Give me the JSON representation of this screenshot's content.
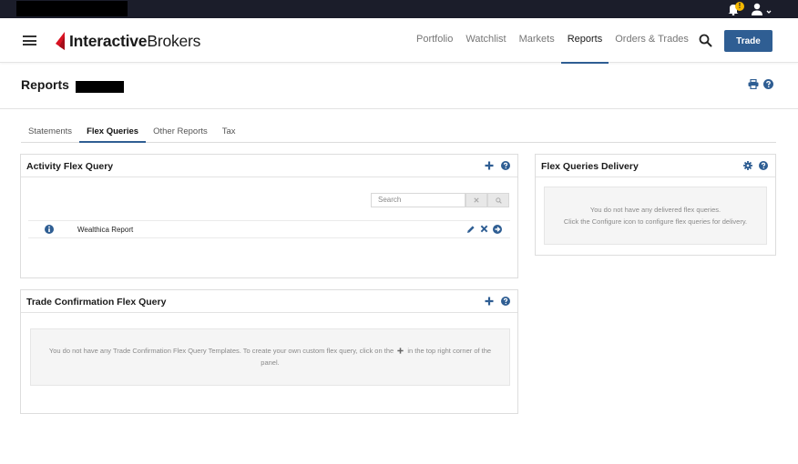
{
  "brand": {
    "name_bold": "Interactive",
    "name_light": "Brokers"
  },
  "notifications": {
    "badge": "!"
  },
  "nav": {
    "links": [
      {
        "label": "Portfolio",
        "active": false
      },
      {
        "label": "Watchlist",
        "active": false
      },
      {
        "label": "Markets",
        "active": false
      },
      {
        "label": "Reports",
        "active": true
      },
      {
        "label": "Orders & Trades",
        "active": false
      }
    ],
    "trade_label": "Trade"
  },
  "page": {
    "title": "Reports"
  },
  "tabs": [
    {
      "label": "Statements",
      "active": false
    },
    {
      "label": "Flex Queries",
      "active": true
    },
    {
      "label": "Other Reports",
      "active": false
    },
    {
      "label": "Tax",
      "active": false
    }
  ],
  "activity_panel": {
    "title": "Activity Flex Query",
    "search_placeholder": "Search",
    "rows": [
      {
        "name": "Wealthica Report"
      }
    ]
  },
  "trade_panel": {
    "title": "Trade Confirmation Flex Query",
    "empty_text_before": "You do not have any Trade Confirmation Flex Query Templates. To create your own custom flex query, click on the",
    "empty_text_after": "in the top right corner of the panel."
  },
  "delivery_panel": {
    "title": "Flex Queries Delivery",
    "empty_line1": "You do not have any delivered flex queries.",
    "empty_line2": "Click the Configure icon to configure flex queries for delivery."
  },
  "colors": {
    "accent": "#2f5e93",
    "topbar": "#1b1d2a",
    "brand_red": "#d81222",
    "badge": "#f5b800"
  },
  "icons": [
    "bell-icon",
    "user-icon",
    "hamburger-icon",
    "search-icon",
    "print-icon",
    "help-icon",
    "plus-icon",
    "gear-icon",
    "info-icon",
    "edit-icon",
    "delete-icon",
    "run-icon",
    "clear-icon"
  ]
}
